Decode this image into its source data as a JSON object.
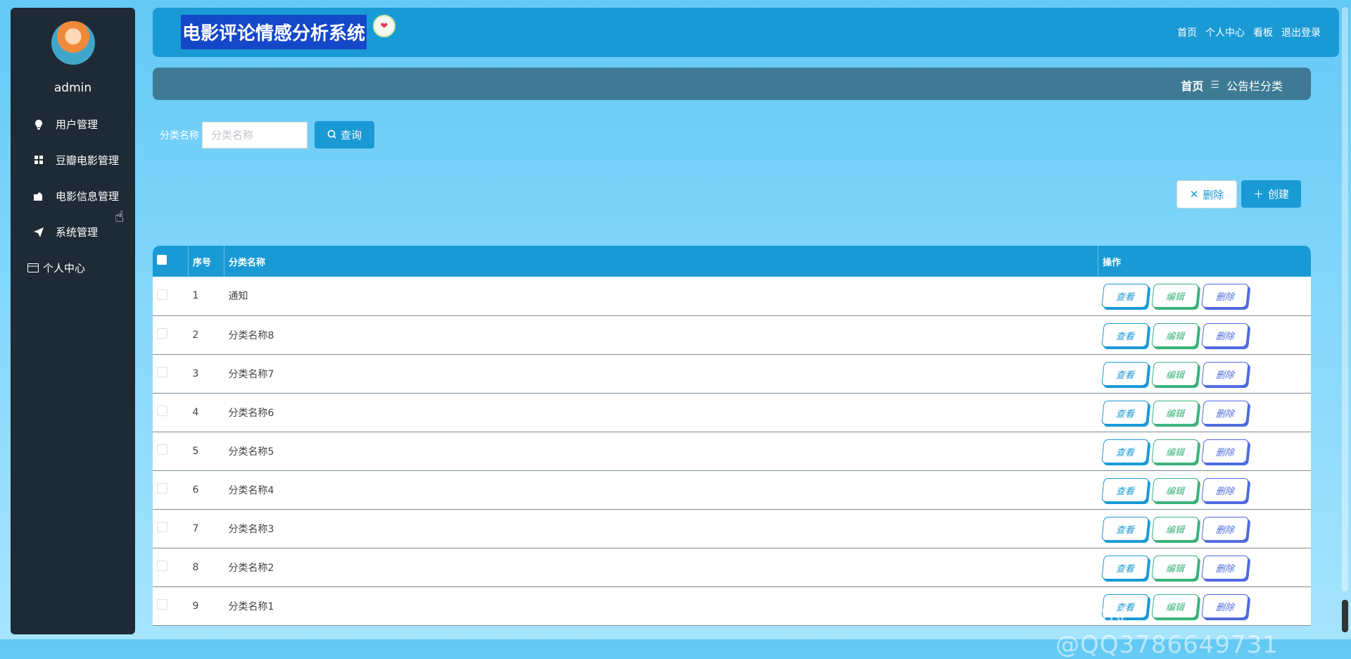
{
  "sidebar": {
    "username": "admin",
    "items": [
      {
        "label": "用户管理",
        "icon": "bulb-icon"
      },
      {
        "label": "豆瓣电影管理",
        "icon": "grid-icon"
      },
      {
        "label": "电影信息管理",
        "icon": "puzzle-icon"
      },
      {
        "label": "系统管理",
        "icon": "paper-plane-icon"
      },
      {
        "label": "个人中心",
        "icon": "card-icon"
      }
    ]
  },
  "header": {
    "title": "电影评论情感分析系统",
    "links": [
      "首页",
      "个人中心",
      "看板",
      "退出登录"
    ]
  },
  "breadcrumb": {
    "home": "首页",
    "separator": "☰",
    "current": "公告栏分类"
  },
  "search": {
    "label": "分类名称",
    "placeholder": "分类名称",
    "button": "查询"
  },
  "actions": {
    "delete": "删除",
    "create": "创建"
  },
  "table": {
    "headers": [
      "序号",
      "分类名称",
      "操作"
    ],
    "ops": {
      "view": "查看",
      "edit": "编辑",
      "delete": "删除"
    },
    "rows": [
      {
        "no": "1",
        "name": "通知"
      },
      {
        "no": "2",
        "name": "分类名称8"
      },
      {
        "no": "3",
        "name": "分类名称7"
      },
      {
        "no": "4",
        "name": "分类名称6"
      },
      {
        "no": "5",
        "name": "分类名称5"
      },
      {
        "no": "6",
        "name": "分类名称4"
      },
      {
        "no": "7",
        "name": "分类名称3"
      },
      {
        "no": "8",
        "name": "分类名称2"
      },
      {
        "no": "9",
        "name": "分类名称1"
      }
    ]
  },
  "watermark": "CSDN @QQ3786649731",
  "colors": {
    "primary": "#1a9ad5",
    "sidebar": "#1e2a35",
    "edit": "#3bb37a",
    "delete": "#4f6be0"
  }
}
